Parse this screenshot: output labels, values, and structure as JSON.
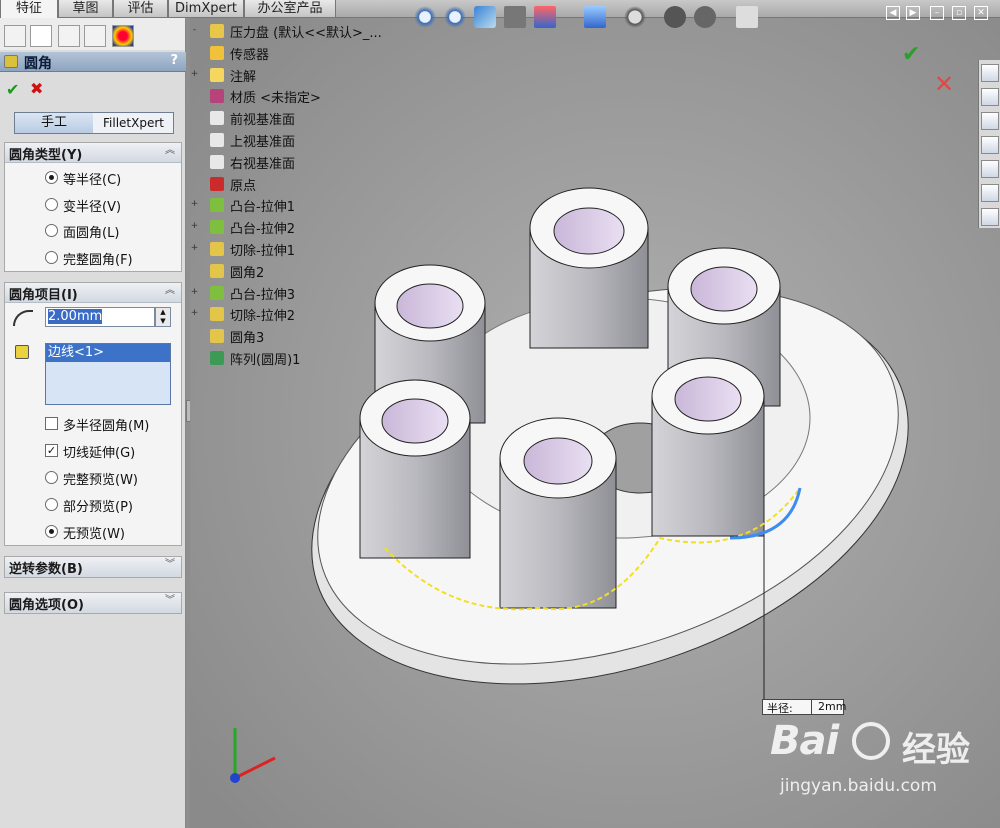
{
  "tabs": [
    "特征",
    "草图",
    "评估",
    "DimXpert",
    "办公室产品"
  ],
  "panel": {
    "title": "圆角",
    "help": "?",
    "mode_tabs": [
      "手工",
      "FilletXpert"
    ],
    "fillet_type": {
      "title": "圆角类型(Y)",
      "options": [
        "等半径(C)",
        "变半径(V)",
        "面圆角(L)",
        "完整圆角(F)"
      ],
      "selected": 0
    },
    "fillet_items": {
      "title": "圆角项目(I)",
      "radius": "2.00mm",
      "edges": [
        "边线<1>"
      ],
      "checks": [
        {
          "label": "多半径圆角(M)",
          "checked": false
        },
        {
          "label": "切线延伸(G)",
          "checked": true
        }
      ],
      "preview": [
        "完整预览(W)",
        "部分预览(P)",
        "无预览(W)"
      ],
      "preview_selected": 2
    },
    "setback": "逆转参数(B)",
    "options": "圆角选项(O)"
  },
  "tree": [
    {
      "label": "压力盘 (默认<<默认>_...",
      "exp": "-",
      "icon": "#e7c64a"
    },
    {
      "label": "传感器",
      "exp": "",
      "icon": "#f0c23a"
    },
    {
      "label": "注解",
      "exp": "+",
      "icon": "#f5d65e"
    },
    {
      "label": "材质 <未指定>",
      "exp": "",
      "icon": "#b6447a"
    },
    {
      "label": "前视基准面",
      "exp": "",
      "icon": "#e8e8e8"
    },
    {
      "label": "上视基准面",
      "exp": "",
      "icon": "#e8e8e8"
    },
    {
      "label": "右视基准面",
      "exp": "",
      "icon": "#e8e8e8"
    },
    {
      "label": "原点",
      "exp": "",
      "icon": "#cc2b2b"
    },
    {
      "label": "凸台-拉伸1",
      "exp": "+",
      "icon": "#7fbf3f"
    },
    {
      "label": "凸台-拉伸2",
      "exp": "+",
      "icon": "#7fbf3f"
    },
    {
      "label": "切除-拉伸1",
      "exp": "+",
      "icon": "#e3c54a"
    },
    {
      "label": "圆角2",
      "exp": "",
      "icon": "#e3c54a"
    },
    {
      "label": "凸台-拉伸3",
      "exp": "+",
      "icon": "#7fbf3f"
    },
    {
      "label": "切除-拉伸2",
      "exp": "+",
      "icon": "#e3c54a"
    },
    {
      "label": "圆角3",
      "exp": "",
      "icon": "#e3c54a"
    },
    {
      "label": "阵列(圆周)1",
      "exp": "",
      "icon": "#3b9b55"
    }
  ],
  "callout": {
    "label": "半径:",
    "value": "2mm"
  },
  "watermark": {
    "brand": "Bai",
    "brand2": "经验",
    "url": "jingyan.baidu.com"
  }
}
